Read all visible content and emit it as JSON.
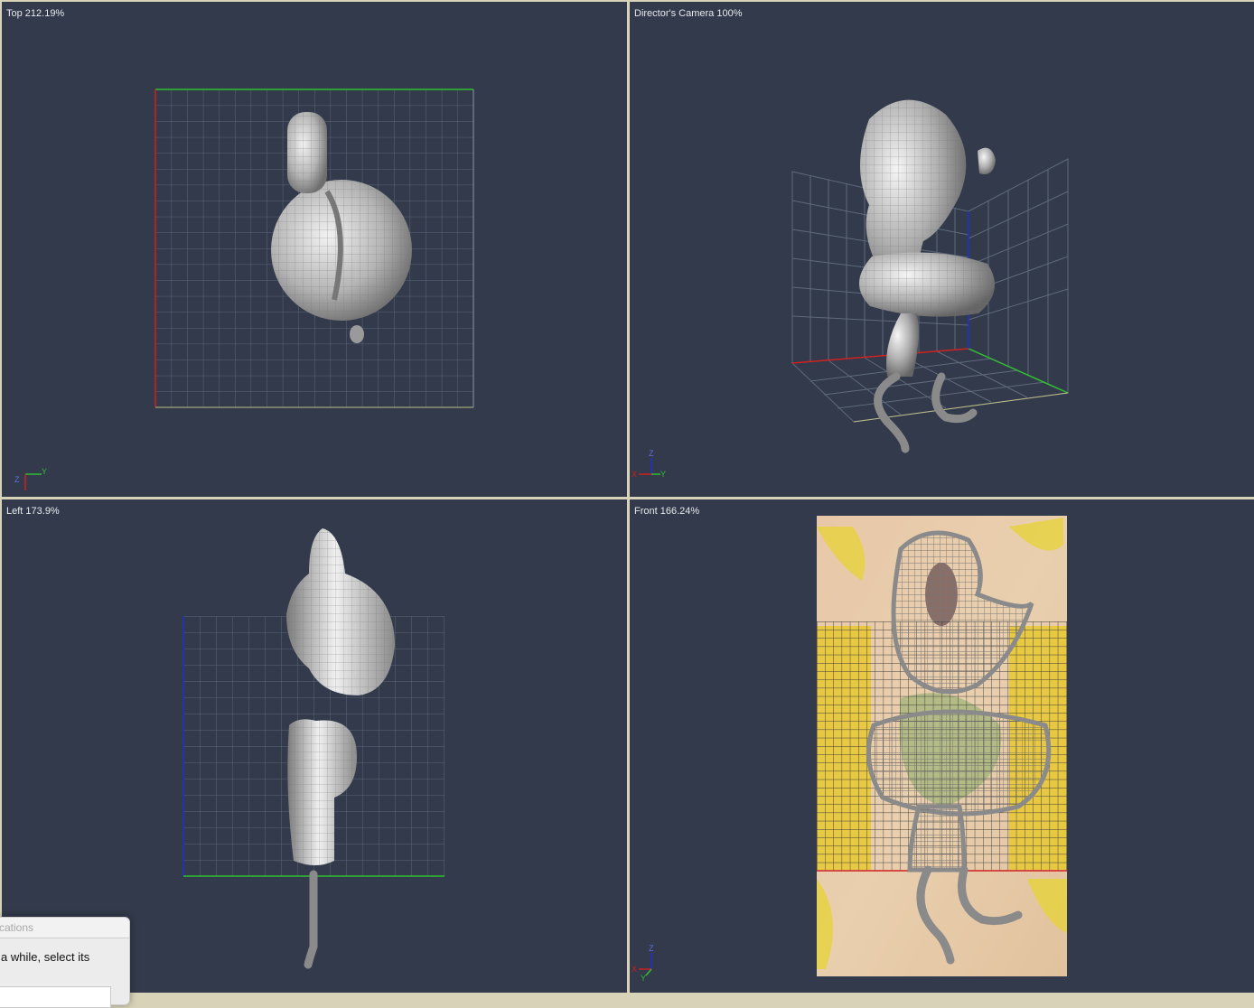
{
  "viewports": {
    "top": {
      "label": "Top 212.19%"
    },
    "camera": {
      "label": "Director's Camera 100%"
    },
    "left": {
      "label": "Left 173.9%"
    },
    "front": {
      "label": "Front 166.24%"
    }
  },
  "axes": {
    "top": {
      "y": "Y",
      "z": "Z"
    },
    "camera": {
      "z": "Z",
      "x": "X",
      "y": "Y"
    },
    "front": {
      "z": "Z",
      "x": "X",
      "y": "Y"
    }
  },
  "dialog": {
    "title": "cations",
    "text": "a while, select its",
    "field_value": ""
  },
  "colors": {
    "viewport_bg": "#323a4b",
    "grid": "#6a7585",
    "axis_x": "#d02020",
    "axis_y": "#30c030",
    "axis_z": "#2030d0",
    "model": "#b8b8b8",
    "frame": "#d8d3b8"
  }
}
